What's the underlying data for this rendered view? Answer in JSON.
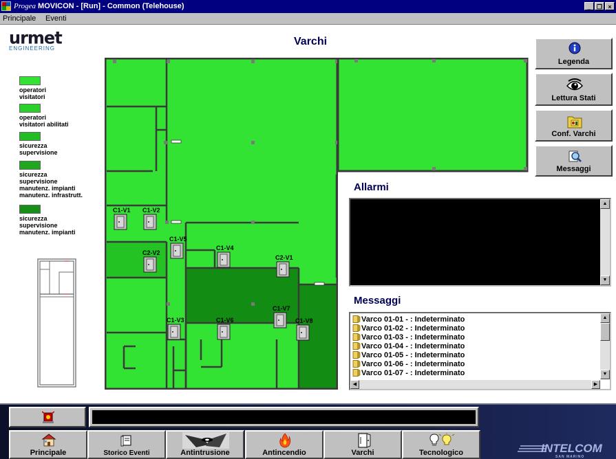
{
  "window": {
    "title_italic": "Progea",
    "title": "MOVICON - [Run] - Common (Telehouse)",
    "minimize": "_",
    "restore": "❐",
    "close": "×"
  },
  "menu": {
    "items": [
      "Principale",
      "Eventi"
    ]
  },
  "logo": {
    "brand": "urmet",
    "sub": "ENGINEERING"
  },
  "legend": [
    {
      "color": "#33e333",
      "text": "operatori\nvisitatori"
    },
    {
      "color": "#2bd02b",
      "text": "operatori\nvisitatori abilitati"
    },
    {
      "color": "#22bd22",
      "text": "sicurezza\nsupervisione"
    },
    {
      "color": "#1fa81f",
      "text": "sicurezza\nsupervisione\nmanutenz. impianti\nmanutenz. infrastrutt."
    },
    {
      "color": "#178e17",
      "text": "sicurezza\nsupervisione\nmanutenz. impianti"
    }
  ],
  "page_title": "Varchi",
  "colors": {
    "zone_light": "#33e333",
    "zone_mid": "#22c322",
    "zone_dark": "#128c12",
    "wall": "#3a3a3a"
  },
  "map": {
    "doors": [
      "C1-V1",
      "C1-V2",
      "C2-V2",
      "C1-V5",
      "C1-V4",
      "C2-V1",
      "C1-V3",
      "C1-V6",
      "C1-V7",
      "C1-V8"
    ]
  },
  "alarms": {
    "title": "Allarmi"
  },
  "messages": {
    "title": "Messaggi",
    "items": [
      "Varco 01-01 -  : Indeterminato",
      "Varco 01-02 -  : Indeterminato",
      "Varco 01-03 -  : Indeterminato",
      "Varco 01-04 -  : Indeterminato",
      "Varco 01-05 -  : Indeterminato",
      "Varco 01-06 -  : Indeterminato",
      "Varco 01-07 -  : Indeterminato"
    ]
  },
  "side_buttons": [
    {
      "label": "Legenda",
      "icon": "info-icon"
    },
    {
      "label": "Lettura Stati",
      "icon": "eye-icon"
    },
    {
      "label": "Conf. Varchi",
      "icon": "folder-config-icon"
    },
    {
      "label": "Messaggi",
      "icon": "magnifier-icon"
    }
  ],
  "nav_buttons": [
    {
      "label": "Principale",
      "icon": "house-icon"
    },
    {
      "label": "Storico Eventi",
      "icon": "book-icon"
    },
    {
      "label": "Antintrusione",
      "icon": "intruder-icon"
    },
    {
      "label": "Antincendio",
      "icon": "fire-icon"
    },
    {
      "label": "Varchi",
      "icon": "door-icon"
    },
    {
      "label": "Tecnologico",
      "icon": "lightbulb-icon"
    }
  ],
  "brand_footer": {
    "name": "INTELCOM",
    "sub": "SAN MARINO"
  }
}
